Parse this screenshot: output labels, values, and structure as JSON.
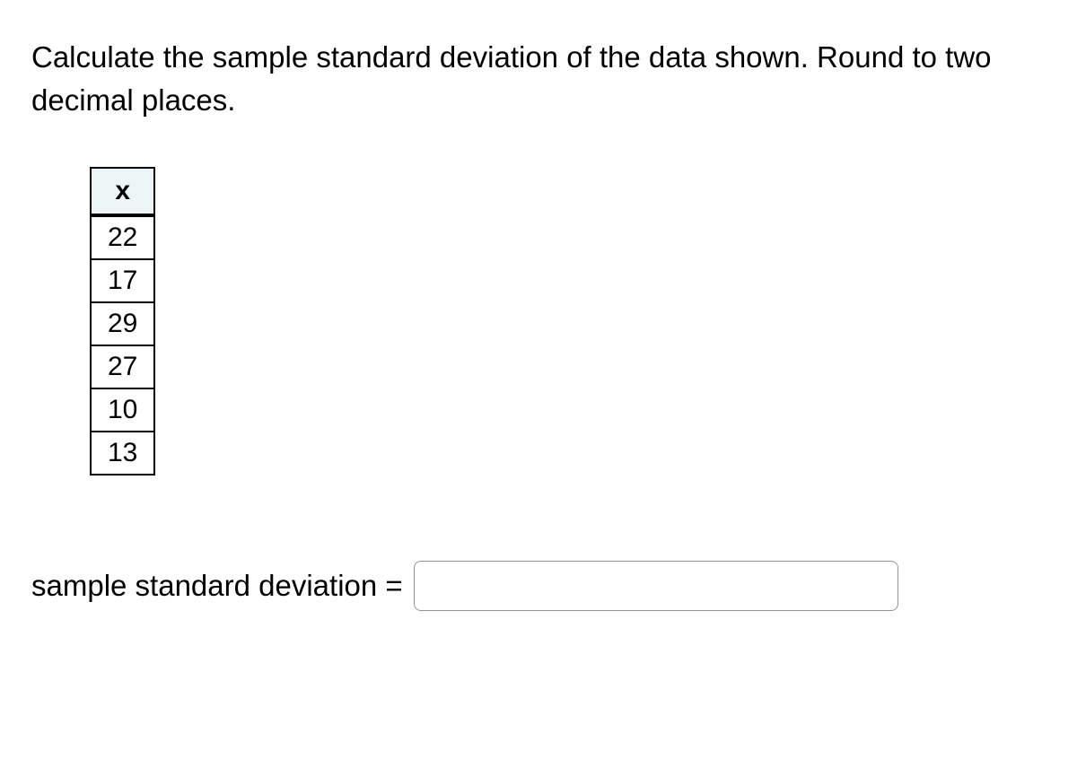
{
  "prompt": "Calculate the sample standard deviation of the data shown. Round to two decimal places.",
  "table": {
    "header": "x",
    "values": [
      "22",
      "17",
      "29",
      "27",
      "10",
      "13"
    ]
  },
  "answer": {
    "label": "sample standard deviation = ",
    "value": ""
  }
}
